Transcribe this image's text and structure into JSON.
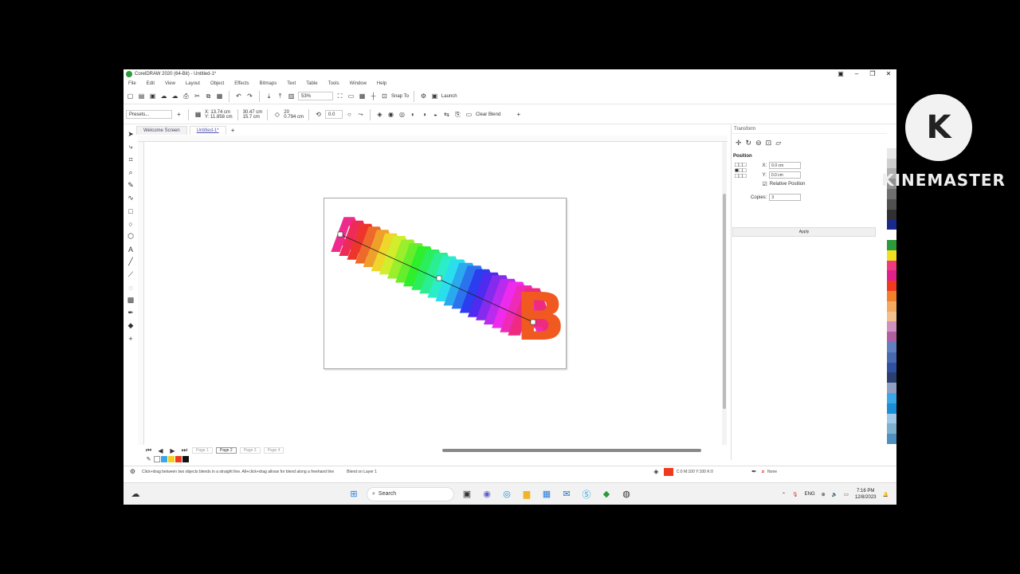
{
  "window": {
    "title": "CorelDRAW 2020 (64-Bit) - Untitled-1*"
  },
  "menu": [
    "File",
    "Edit",
    "View",
    "Layout",
    "Object",
    "Effects",
    "Bitmaps",
    "Text",
    "Table",
    "Tools",
    "Window",
    "Help"
  ],
  "toolbar1": {
    "zoom": "53%",
    "snap_to": "Snap To",
    "launch": "Launch"
  },
  "toolbar2": {
    "presets": "Presets...",
    "pos_x": "X: 13.74 cm",
    "pos_y": "Y: 11.858 cm",
    "size_w": "30.47 cm",
    "size_h": "15.7 cm",
    "steps": "20",
    "step_spacing": "0.794 cm",
    "rotation": "0.0",
    "clear_blend": "Clear Blend"
  },
  "tabs": [
    "Welcome Screen",
    "Untitled-1*"
  ],
  "pages": [
    "Page 1",
    "Page 2",
    "Page 3",
    "Page 4"
  ],
  "docker": {
    "title": "Transform",
    "section": "Position",
    "x_label": "X:",
    "x_value": "0.0 cm",
    "y_label": "Y:",
    "y_value": "0.0 cm",
    "relative_position": "Relative Position",
    "copies_label": "Copies:",
    "copies_value": "3",
    "apply": "Apply"
  },
  "status": {
    "hint": "Click+drag between two objects blends in a straight line. Alt+click+drag allows for blend along a freehand line",
    "object": "Blend on Layer 1",
    "fill_info": "C:0 M:100 Y:100 K:0",
    "outline": "None"
  },
  "taskbar": {
    "search": "Search",
    "lang": "ENG",
    "time": "7:16 PM",
    "date": "12/8/2023"
  },
  "blend": {
    "start_letter": "A",
    "end_letter": "B"
  },
  "watermark": {
    "text": "KINEMASTER",
    "letter": "K"
  },
  "colors": {
    "accent": "#2a9a3a",
    "blend_start": "#f03a20",
    "blend_end": "#f05a20"
  }
}
